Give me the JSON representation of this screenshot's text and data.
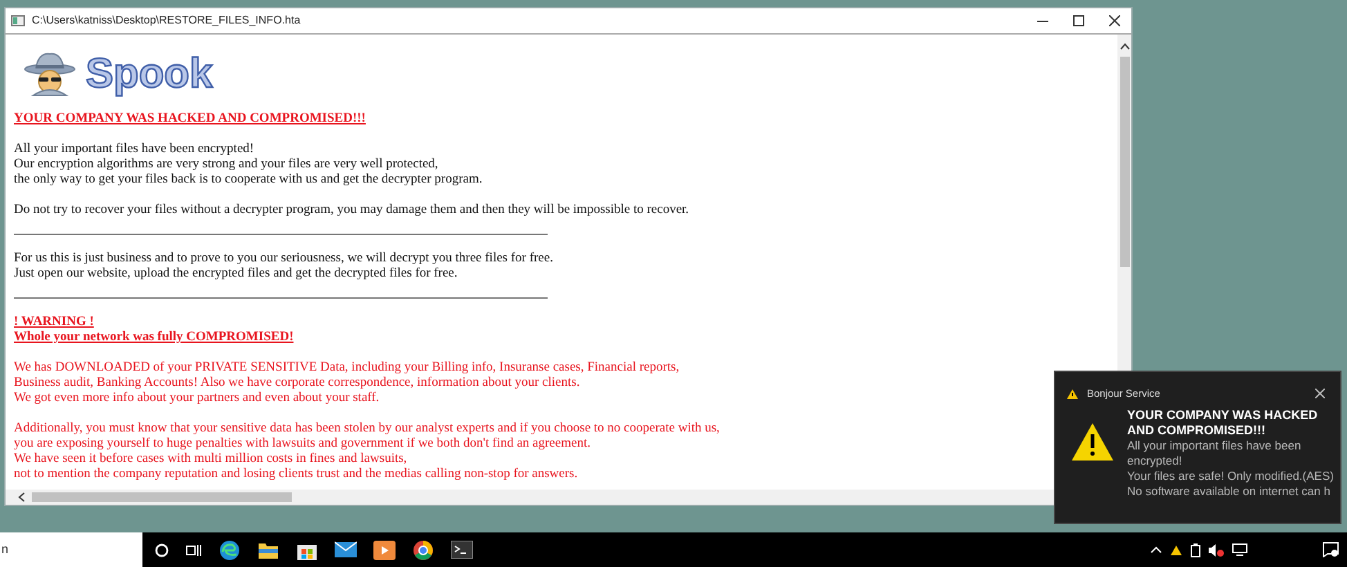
{
  "window": {
    "title": "C:\\Users\\katniss\\Desktop\\RESTORE_FILES_INFO.hta"
  },
  "logo": {
    "text": "Spook"
  },
  "blocks": [
    {
      "kind": "heading",
      "lines": [
        "YOUR COMPANY WAS HACKED AND COMPROMISED!!!"
      ]
    },
    {
      "kind": "text",
      "lines": [
        "All your important files have been encrypted!",
        "Our encryption algorithms are very strong and your files are very well protected,",
        "the only way to get your files back is to cooperate with us and get the decrypter program."
      ]
    },
    {
      "kind": "text",
      "lines": [
        "Do not try to recover your files without a decrypter program, you may damage them and then they will be impossible to recover."
      ]
    },
    {
      "kind": "rule"
    },
    {
      "kind": "text",
      "lines": [
        "For us this is just business and to prove to you our seriousness, we will decrypt you three files for free.",
        "Just open our website, upload the encrypted files and get the decrypted files for free."
      ]
    },
    {
      "kind": "rule"
    },
    {
      "kind": "heading",
      "lines": [
        "! WARNING !",
        "Whole your network was fully COMPROMISED!"
      ]
    },
    {
      "kind": "alert",
      "lines": [
        "We has DOWNLOADED of your PRIVATE SENSITIVE Data, including your Billing info, Insuranse cases, Financial reports,",
        "Business audit, Banking Accounts! Also we have corporate correspondence, information about your clients.",
        "We got even more info about your partners and even about your staff."
      ]
    },
    {
      "kind": "alert",
      "lines": [
        "Additionally, you must know that your sensitive data has been stolen by our analyst experts and if you choose to no cooperate with us,",
        "you are exposing yourself to huge penalties with lawsuits and government if we both don't find an agreement.",
        "We have seen it before cases with multi million costs in fines and lawsuits,",
        "not to mention the company reputation and losing clients trust and the medias calling non-stop for answers."
      ]
    }
  ],
  "notification": {
    "app": "Bonjour Service",
    "title": "YOUR COMPANY WAS HACKED AND COMPROMISED!!!",
    "lines": [
      "All your important files have been encrypted!",
      "Your files are safe! Only modified.(AES)",
      "No software available on internet can h"
    ]
  },
  "taskbar": {
    "search_text": "n"
  }
}
